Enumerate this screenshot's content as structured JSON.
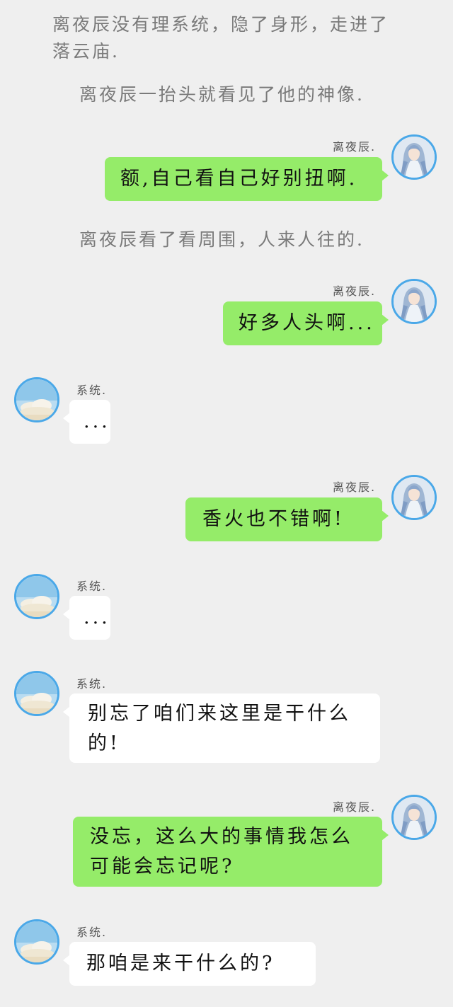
{
  "narrations": [
    "离夜辰没有理系统，隐了身形，走进了落云庙.",
    "离夜辰一抬头就看见了他的神像.",
    "离夜辰看了看周围，人来人往的."
  ],
  "names": {
    "hero": "离夜辰.",
    "system": "系统."
  },
  "messages": [
    {
      "sender": "hero",
      "text": "额,自己看自己好别扭啊."
    },
    {
      "sender": "hero",
      "text": "好多人头啊..."
    },
    {
      "sender": "system",
      "text": "..."
    },
    {
      "sender": "hero",
      "text": "香火也不错啊!"
    },
    {
      "sender": "system",
      "text": "..."
    },
    {
      "sender": "system",
      "text": "别忘了咱们来这里是干什么的!"
    },
    {
      "sender": "hero",
      "text": "没忘，这么大的事情我怎么可能会忘记呢?"
    },
    {
      "sender": "system",
      "text": "那咱是来干什么的?"
    }
  ],
  "colors": {
    "background": "#efefef",
    "bubble_sent": "#95ec69",
    "bubble_received": "#ffffff",
    "avatar_ring": "#4aa8e8",
    "narration_text": "#7a7a7a"
  },
  "icons": {
    "hero_avatar": "hero-portrait-avatar",
    "system_avatar": "sky-clouds-avatar"
  }
}
